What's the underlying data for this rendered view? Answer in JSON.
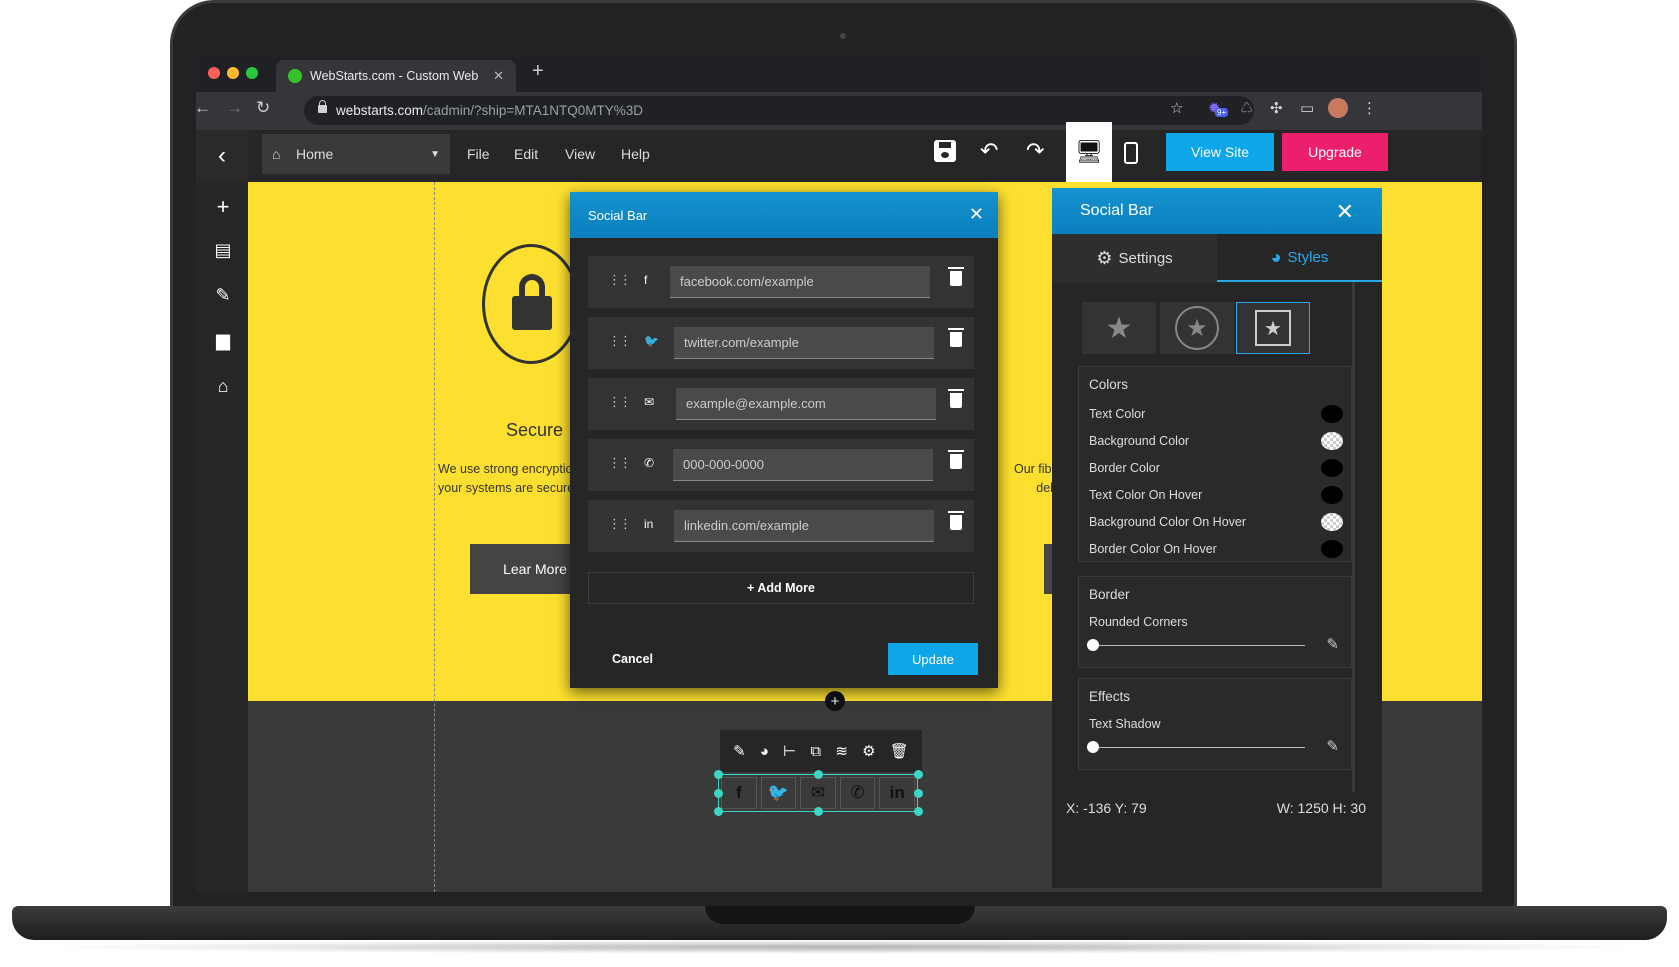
{
  "browser": {
    "tab_title": "WebStarts.com - Custom Web",
    "url_host": "webstarts.com",
    "url_path": "/cadmin/?ship=MTA1NTQ0MTY%3D",
    "extension_badge": "9+"
  },
  "toolbar": {
    "page_select": "Home",
    "menu": [
      "File",
      "Edit",
      "View",
      "Help"
    ],
    "view_site_label": "View Site",
    "upgrade_label": "Upgrade"
  },
  "canvas": {
    "feature_title": "Secure",
    "feature_text_line1": "We use strong encryption",
    "feature_text_line2": "your systems are secure fr",
    "button_label": "Lear More",
    "right_text_line1": "Our fiber",
    "right_text_line2": "deliv"
  },
  "modal": {
    "title": "Social Bar",
    "rows": [
      {
        "icon": "facebook-icon",
        "glyph": "f",
        "value": "facebook.com/example"
      },
      {
        "icon": "twitter-icon",
        "glyph": "🐦",
        "value": "twitter.com/example"
      },
      {
        "icon": "email-icon",
        "glyph": "✉",
        "value": "example@example.com"
      },
      {
        "icon": "phone-icon",
        "glyph": "✆",
        "value": "000-000-0000"
      },
      {
        "icon": "linkedin-icon",
        "glyph": "in",
        "value": "linkedin.com/example"
      }
    ],
    "add_more_label": "+ Add More",
    "cancel_label": "Cancel",
    "update_label": "Update"
  },
  "panel": {
    "title": "Social Bar",
    "tabs": {
      "settings": "Settings",
      "styles": "Styles"
    },
    "colors": {
      "title": "Colors",
      "items": [
        {
          "label": "Text Color",
          "swatch": "#000000"
        },
        {
          "label": "Background Color",
          "swatch": "transparent"
        },
        {
          "label": "Border Color",
          "swatch": "#000000"
        },
        {
          "label": "Text Color On Hover",
          "swatch": "#000000"
        },
        {
          "label": "Background Color On Hover",
          "swatch": "transparent"
        },
        {
          "label": "Border Color On Hover",
          "swatch": "#000000"
        }
      ]
    },
    "border": {
      "title": "Border",
      "label": "Rounded Corners",
      "value": 0
    },
    "effects": {
      "title": "Effects",
      "label": "Text Shadow",
      "value": 0
    },
    "coords": "X: -136 Y: 79",
    "dims": "W: 1250 H: 30"
  },
  "colors": {
    "accent_blue": "#0ea5e9",
    "upgrade_pink": "#ec1f6c",
    "canvas_yellow": "#fde02f",
    "selection": "#3bd7c7"
  }
}
